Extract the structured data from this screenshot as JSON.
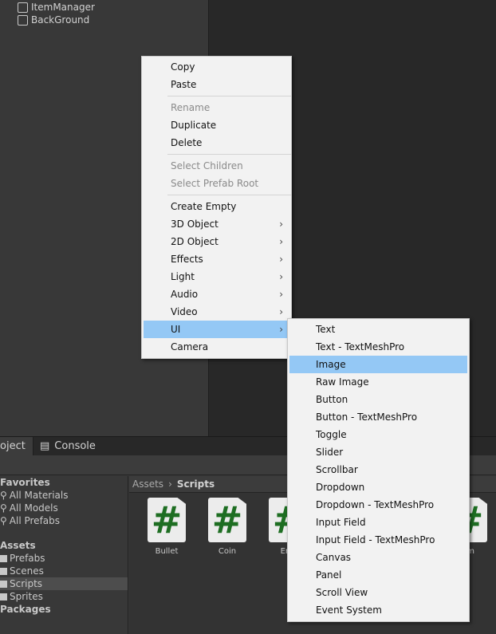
{
  "hierarchy": {
    "items": [
      "ItemManager",
      "BackGround"
    ]
  },
  "bottom": {
    "tabs": [
      "oject",
      "Console"
    ],
    "left": {
      "favorites_header": "Favorites",
      "favorites": [
        "All Materials",
        "All Models",
        "All Prefabs"
      ],
      "assets_header": "Assets",
      "folders": [
        "Prefabs",
        "Scenes",
        "Scripts",
        "Sprites"
      ],
      "selected_folder": "Scripts",
      "packages_header": "Packages"
    },
    "breadcrumb": [
      "Assets",
      "Scripts"
    ],
    "assets": [
      {
        "label": "Bullet"
      },
      {
        "label": "Coin"
      },
      {
        "label": "Ene"
      },
      {
        "label": "em"
      }
    ]
  },
  "context_menu": {
    "groups": [
      [
        {
          "label": "Copy"
        },
        {
          "label": "Paste"
        }
      ],
      [
        {
          "label": "Rename",
          "disabled": true
        },
        {
          "label": "Duplicate"
        },
        {
          "label": "Delete"
        }
      ],
      [
        {
          "label": "Select Children",
          "disabled": true
        },
        {
          "label": "Select Prefab Root",
          "disabled": true
        }
      ],
      [
        {
          "label": "Create Empty"
        },
        {
          "label": "3D Object",
          "submenu": true
        },
        {
          "label": "2D Object",
          "submenu": true
        },
        {
          "label": "Effects",
          "submenu": true
        },
        {
          "label": "Light",
          "submenu": true
        },
        {
          "label": "Audio",
          "submenu": true
        },
        {
          "label": "Video",
          "submenu": true
        },
        {
          "label": "UI",
          "submenu": true,
          "highlighted": true
        },
        {
          "label": "Camera"
        }
      ]
    ]
  },
  "ui_submenu": {
    "items": [
      "Text",
      "Text - TextMeshPro",
      "Image",
      "Raw Image",
      "Button",
      "Button - TextMeshPro",
      "Toggle",
      "Slider",
      "Scrollbar",
      "Dropdown",
      "Dropdown - TextMeshPro",
      "Input Field",
      "Input Field - TextMeshPro",
      "Canvas",
      "Panel",
      "Scroll View",
      "Event System"
    ],
    "highlighted": "Image"
  },
  "colors": {
    "highlight": "#94c8f5",
    "menu_bg": "#f2f2f2",
    "script_icon": "#1e6e22"
  }
}
